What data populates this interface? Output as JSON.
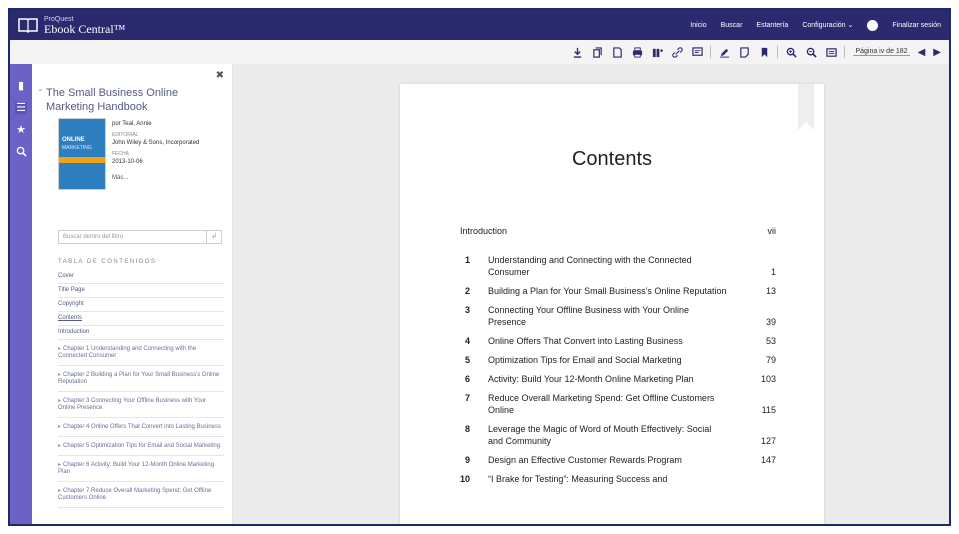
{
  "header": {
    "brand_small": "ProQuest",
    "brand_main": "Ebook Central™",
    "nav": [
      "Inicio",
      "Buscar",
      "Estantería",
      "Configuración ⌄"
    ],
    "logout": "Finalizar sesión"
  },
  "toolbar": {
    "page_label": "Página iv de 182"
  },
  "panel": {
    "title": "The Small Business Online Marketing Handbook",
    "author": "por Teal, Annie",
    "publisher_label": "Editorial",
    "publisher": "John Wiley & Sons, Incorporated",
    "date_label": "Fecha",
    "date": "2013-10-06",
    "more": "Más...",
    "search_placeholder": "Buscar dentro del libro",
    "toc_heading": "TABLA DE CONTENIDOS",
    "toc_items": [
      "Cover",
      "Title Page",
      "Copyright",
      "Contents",
      "Introduction"
    ],
    "toc_chapters": [
      "Chapter 1 Understanding and Connecting with the Connected Consumer",
      "Chapter 2 Building a Plan for Your Small Business's Online Reputation",
      "Chapter 3 Connecting Your Offline Business with Your Online Presence",
      "Chapter 4 Online Offers That Convert into Lasting Business",
      "Chapter 5 Optimization Tips for Email and Social Marketing",
      "Chapter 6 Activity: Build Your 12-Month Online Marketing Plan",
      "Chapter 7 Reduce Overall Marketing Spend: Get Offline Customers Online"
    ],
    "cover": {
      "line1": "ONLINE",
      "line2": "MARKETING"
    }
  },
  "page": {
    "heading": "Contents",
    "intro": {
      "label": "Introduction",
      "page": "vii"
    },
    "entries": [
      {
        "num": "1",
        "text": "Understanding and Connecting with the Connected Consumer",
        "page": "1"
      },
      {
        "num": "2",
        "text": "Building a Plan for Your Small Business’s Online Reputation",
        "page": "13"
      },
      {
        "num": "3",
        "text": "Connecting Your Offline Business with Your Online Presence",
        "page": "39"
      },
      {
        "num": "4",
        "text": "Online Offers That Convert into Lasting Business",
        "page": "53"
      },
      {
        "num": "5",
        "text": "Optimization Tips for Email and Social Marketing",
        "page": "79"
      },
      {
        "num": "6",
        "text": "Activity: Build Your 12-Month Online Marketing Plan",
        "page": "103"
      },
      {
        "num": "7",
        "text": "Reduce Overall Marketing Spend: Get Offline Customers Online",
        "page": "115"
      },
      {
        "num": "8",
        "text": "Leverage the Magic of Word of Mouth Effectively: Social and Community",
        "page": "127"
      },
      {
        "num": "9",
        "text": "Design an Effective Customer Rewards Program",
        "page": "147"
      },
      {
        "num": "10",
        "text": "“I Brake for Testing”: Measuring Success and",
        "page": ""
      }
    ]
  },
  "colors": {
    "topbar": "#2b2a6e",
    "rail": "#6a62c5",
    "link": "#555a86"
  }
}
